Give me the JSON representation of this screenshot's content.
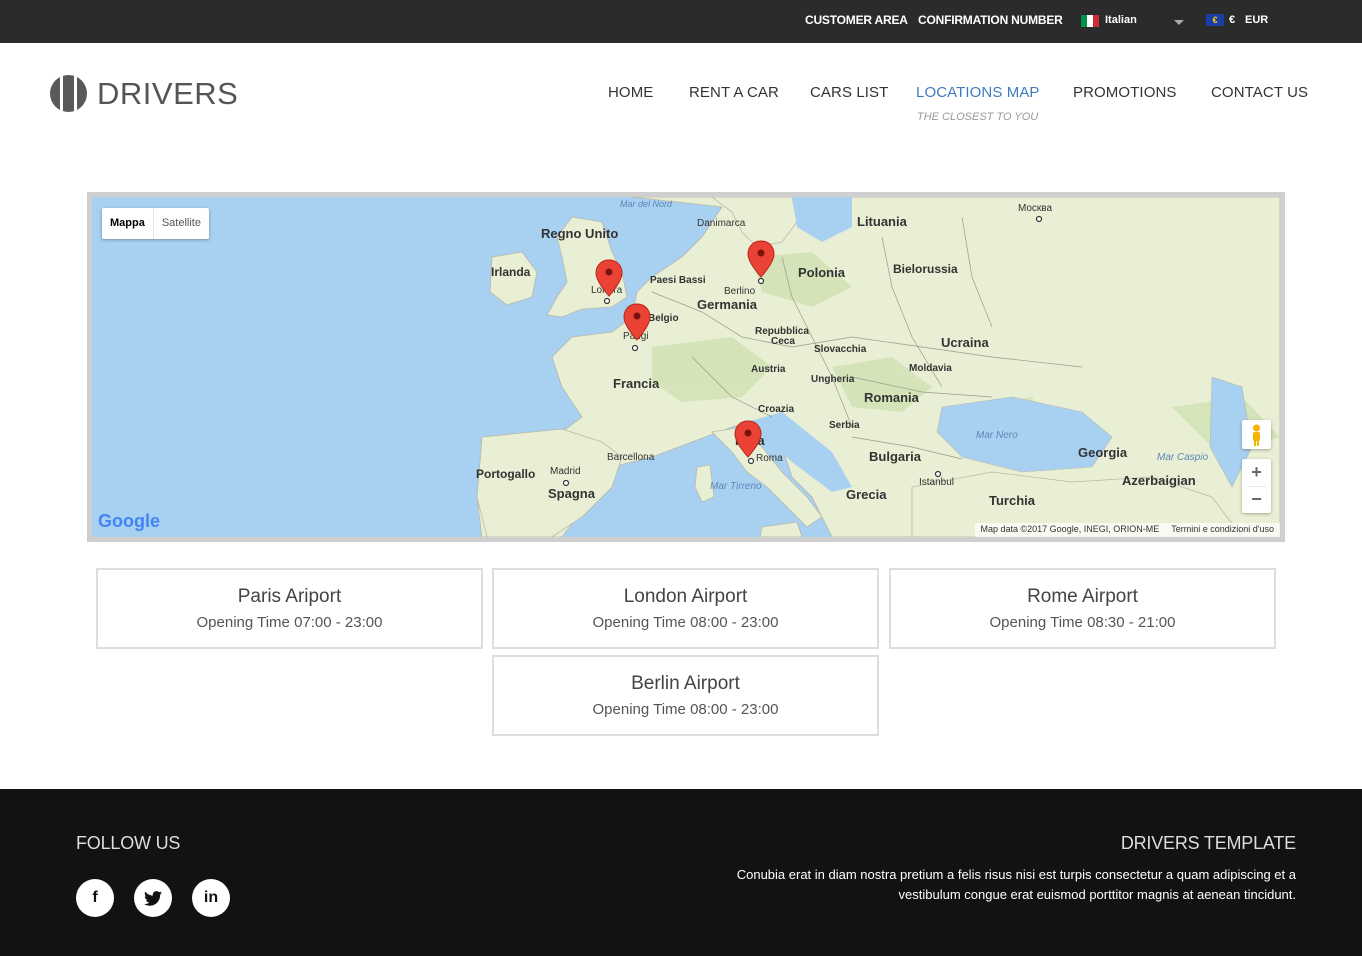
{
  "topbar": {
    "customer_area": "CUSTOMER AREA",
    "confirmation_number": "CONFIRMATION NUMBER",
    "language": "Italian",
    "currency_symbol": "€",
    "currency_code": "EUR"
  },
  "brand": {
    "name": "DRIVERS"
  },
  "nav": {
    "items": [
      "HOME",
      "RENT A CAR",
      "CARS LIST",
      "LOCATIONS MAP",
      "PROMOTIONS",
      "CONTACT US"
    ],
    "active_subtitle": "THE CLOSEST TO YOU",
    "active_color": "#3e7bbf"
  },
  "map": {
    "type_toggle": {
      "map": "Mappa",
      "satellite": "Satellite"
    },
    "labels": {
      "mar_del_nord": "Mar del Nord",
      "danimarca": "Danimarca",
      "lituania": "Lituania",
      "mosca": "Mосква",
      "regno_unito": "Regno Unito",
      "irlanda": "Irlanda",
      "paesi_bassi": "Paesi Bassi",
      "polonia": "Polonia",
      "bielorussia": "Bielorussia",
      "londra": "Londra",
      "berlino": "Berlino",
      "germania": "Germania",
      "belgio": "Belgio",
      "parigi": "Parigi",
      "rep_ceca_1": "Repubblica",
      "rep_ceca_2": "Ceca",
      "slovacchia": "Slovacchia",
      "ucraina": "Ucraina",
      "austria": "Austria",
      "moldavia": "Moldavia",
      "francia": "Francia",
      "ungheria": "Ungheria",
      "romania": "Romania",
      "croazia": "Croazia",
      "serbia": "Serbia",
      "italia": "Italia",
      "mar_nero": "Mar Nero",
      "barcellona": "Barcellona",
      "roma": "Roma",
      "bulgaria": "Bulgaria",
      "georgia": "Georgia",
      "mar_caspio": "Mar Caspio",
      "portogallo": "Portogallo",
      "madrid": "Madrid",
      "istanbul": "Istanbul",
      "spagna": "Spagna",
      "mar_tirreno": "Mar Tirreno",
      "grecia": "Grecia",
      "turchia": "Turchia",
      "azerbaigian": "Azerbaigian"
    },
    "zoom_in": "+",
    "zoom_out": "−",
    "google": "Google",
    "attribution": "Map data ©2017 Google, INEGI, ORION-ME",
    "terms": "Termini e condizioni d'uso",
    "colors": {
      "water": "#a8d0f0",
      "land": "#e9efd4",
      "green": "#cfe2b2",
      "marker": "#ea4335"
    }
  },
  "locations": [
    {
      "name": "Paris Ariport",
      "hours": "Opening Time 07:00 - 23:00"
    },
    {
      "name": "London Airport",
      "hours": "Opening Time 08:00 - 23:00"
    },
    {
      "name": "Rome Airport",
      "hours": "Opening Time 08:30 - 21:00"
    },
    {
      "name": "Berlin Airport",
      "hours": "Opening Time 08:00 - 23:00"
    }
  ],
  "footer": {
    "follow_us": "FOLLOW US",
    "social_icons": [
      "facebook-icon",
      "twitter-icon",
      "linkedin-icon"
    ],
    "title": "DRIVERS TEMPLATE",
    "text": "Conubia erat in diam nostra pretium a felis risus nisi est turpis consectetur a quam adipiscing et a vestibulum congue erat euismod porttitor magnis at aenean tincidunt."
  }
}
